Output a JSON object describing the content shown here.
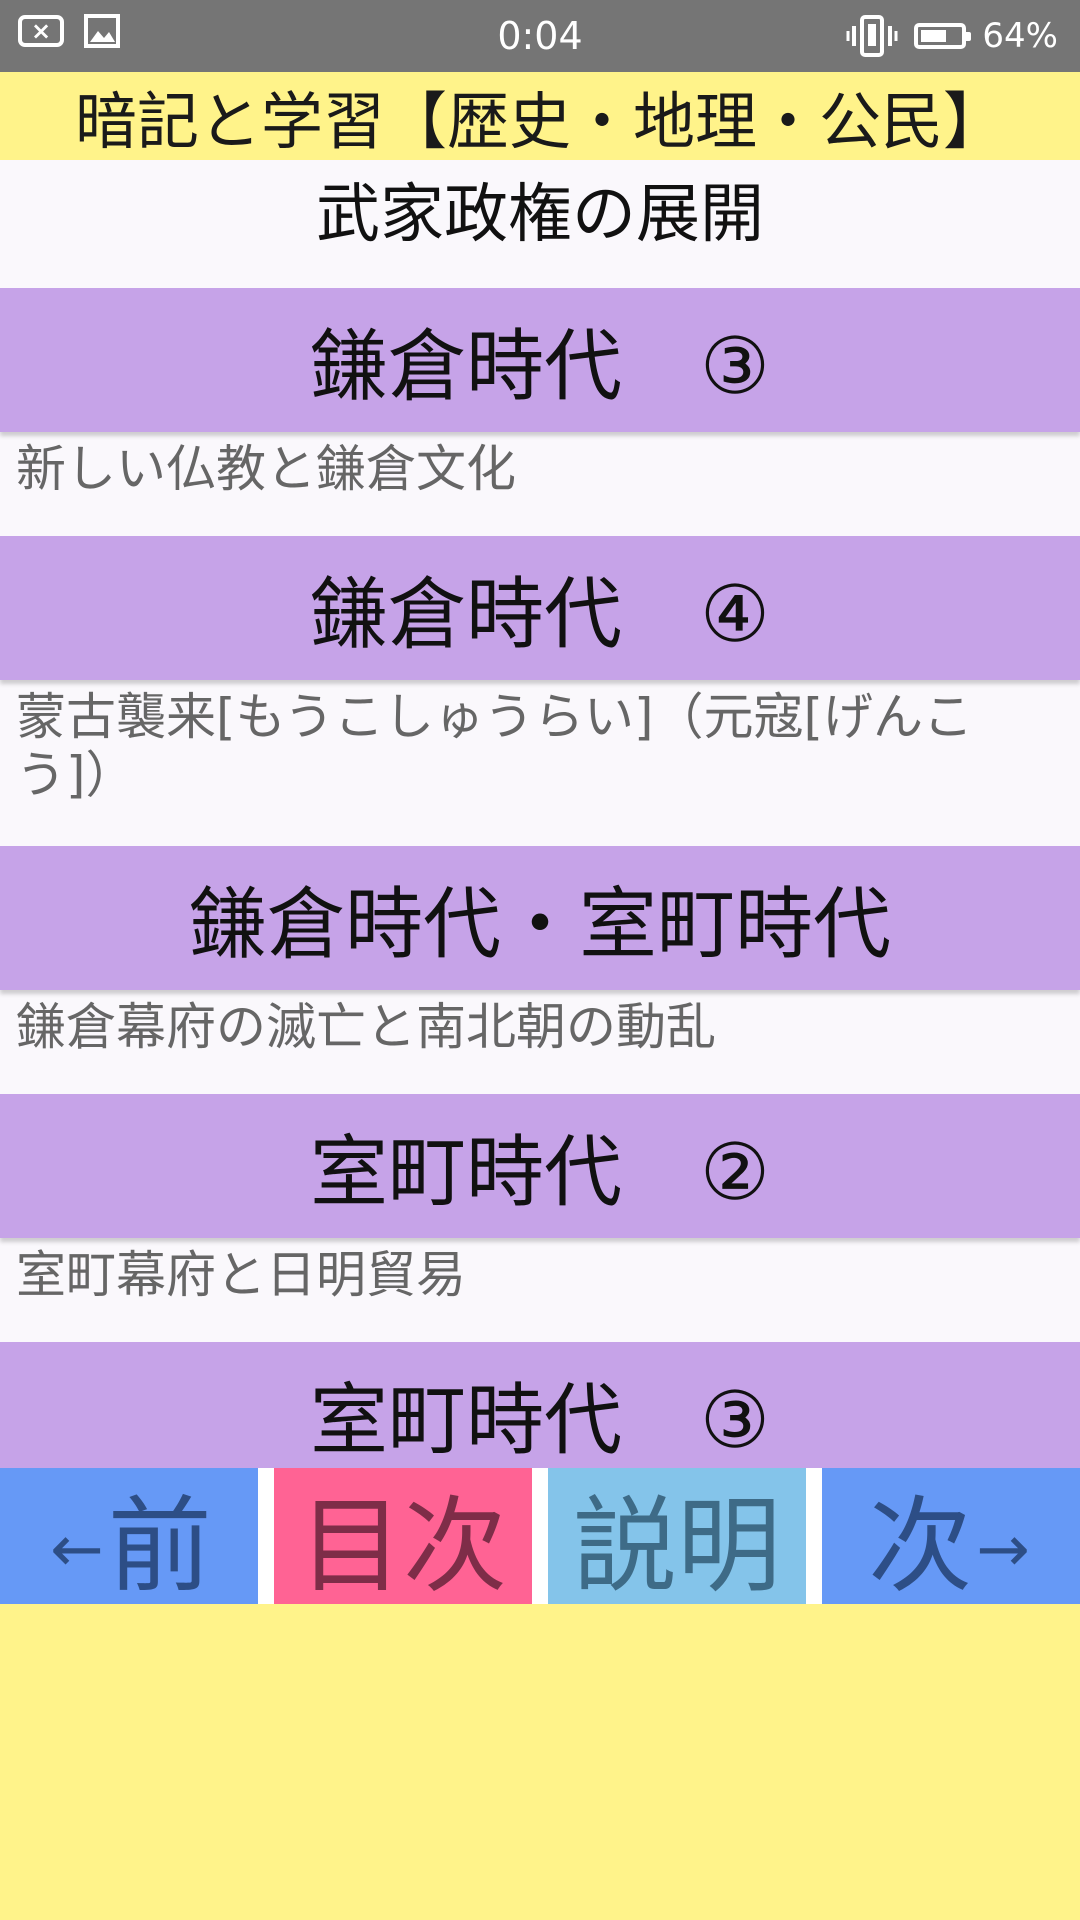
{
  "status_bar": {
    "time": "0:04",
    "battery_percent": "64%",
    "battery_level": 0.64,
    "left_icons": [
      "close-box-icon",
      "image-icon"
    ],
    "right_icons": [
      "vibrate-icon",
      "battery-icon"
    ],
    "close_glyph": "×"
  },
  "app": {
    "title": "暗記と学習【歴史・地理・公民】"
  },
  "content": {
    "section_heading": "武家政権の展開",
    "items": [
      {
        "title": "鎌倉時代　③",
        "subtitle": "新しい仏教と鎌倉文化"
      },
      {
        "title": "鎌倉時代　④",
        "subtitle": "蒙古襲来[もうこしゅうらい]（元寇[げんこう]）"
      },
      {
        "title": "鎌倉時代・室町時代",
        "subtitle": "鎌倉幕府の滅亡と南北朝の動乱"
      },
      {
        "title": "室町時代　②",
        "subtitle": "室町幕府と日明貿易"
      },
      {
        "title": "室町時代　③",
        "subtitle": ""
      }
    ]
  },
  "nav": {
    "prev_arrow": "←",
    "prev_label": "前",
    "toc_label": "目次",
    "help_label": "説明",
    "next_label": "次",
    "next_arrow": "→"
  },
  "colors": {
    "title_bar": "#fff38a",
    "item_bar": "#c6a3e8",
    "prev_next": "#6699f6",
    "toc": "#ff6394",
    "help": "#84c4ea",
    "status_bar": "#757575"
  }
}
